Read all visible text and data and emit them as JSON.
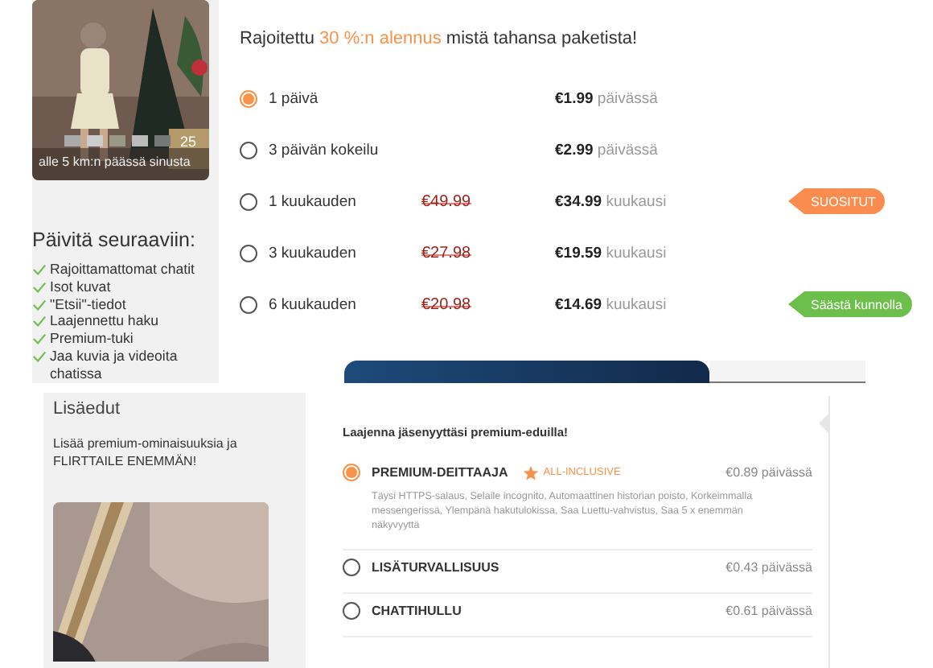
{
  "profile_card": {
    "age": "25",
    "distance": "alle 5 km:n päässä sinusta"
  },
  "benefits": {
    "title": "Päivitä seuraaviin:",
    "items": [
      "Rajoittamattomat chatit",
      "Isot kuvat",
      "\"Etsii\"-tiedot",
      "Laajennettu haku",
      "Premium-tuki",
      "Jaa kuvia ja videoita chatissa"
    ]
  },
  "offer": {
    "prefix": "Rajoitettu ",
    "highlight": "30 %:n alennus",
    "suffix": " mistä tahansa paketista!"
  },
  "plans": [
    {
      "label": "1 päivä",
      "selected": true,
      "price": "€1.99",
      "unit": "päivässä"
    },
    {
      "label": "3 päivän kokeilu",
      "selected": false,
      "price": "€2.99",
      "unit": "päivässä"
    },
    {
      "label": "1 kuukauden",
      "selected": false,
      "old_price": "€49.99",
      "price": "€34.99",
      "unit": "kuukausi",
      "badge": {
        "text": "SUOSITUT",
        "color": "#fb8c4f"
      }
    },
    {
      "label": "3 kuukauden",
      "selected": false,
      "old_price": "€27.98",
      "price": "€19.59",
      "unit": "kuukausi"
    },
    {
      "label": "6 kuukauden",
      "selected": false,
      "old_price": "€20.98",
      "price": "€14.69",
      "unit": "kuukausi",
      "badge": {
        "text": "Säästä kunnolla",
        "color": "#6cbf4a"
      }
    }
  ],
  "extras_panel": {
    "title": "Lisäedut",
    "text": "Lisää premium-ominaisuuksia ja FLIRTTAILE ENEMMÄN!"
  },
  "addons": {
    "title": "Laajenna jäsenyyttäsi premium-eduilla!",
    "items": [
      {
        "name": "PREMIUM-DEITTAAJA",
        "selected": true,
        "tag": "ALL-INCLUSIVE",
        "price": "€0.89 päivässä",
        "description": "Täysi HTTPS-salaus, Selaile incognito, Automaattinen historian poisto, Korkeimmalla messengerissä, Ylempänä hakutulokissa, Saa Luettu-vahvistus, Saa 5 x enemmän näkyvyyttä"
      },
      {
        "name": "LISÄTURVALLISUUS",
        "selected": false,
        "price": "€0.43 päivässä"
      },
      {
        "name": "CHATTIHULLU",
        "selected": false,
        "price": "€0.61 päivässä"
      }
    ]
  }
}
